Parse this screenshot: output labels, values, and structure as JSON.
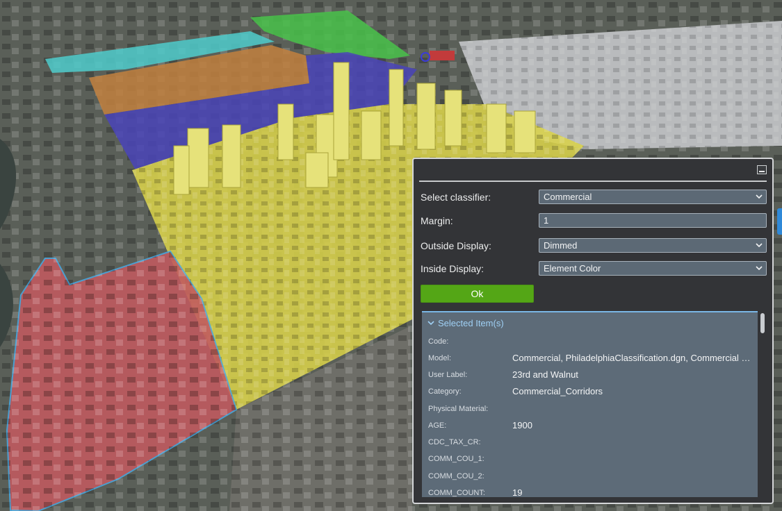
{
  "viewport": {
    "name": "3D city map — Philadelphia classification",
    "zones": [
      {
        "name": "commercial-zone-yellow",
        "color": "#d8d24a"
      },
      {
        "name": "residential-zone-red",
        "color": "#c25a5f"
      },
      {
        "name": "zone-blue",
        "color": "#4a44b8"
      },
      {
        "name": "zone-orange",
        "color": "#c2803e"
      },
      {
        "name": "zone-cyan",
        "color": "#4fcbcb"
      },
      {
        "name": "zone-green",
        "color": "#49c24a"
      }
    ]
  },
  "panel": {
    "minimize_icon": "minimize-icon",
    "classifier": {
      "label": "Select classifier:",
      "value": "Commercial"
    },
    "margin": {
      "label": "Margin:",
      "value": "1"
    },
    "outside_display": {
      "label": "Outside Display:",
      "value": "Dimmed"
    },
    "inside_display": {
      "label": "Inside Display:",
      "value": "Element Color"
    },
    "ok_label": "Ok",
    "selected_items": {
      "title": "Selected Item(s)",
      "rows": [
        {
          "key": "Code:",
          "value": ""
        },
        {
          "key": "Model:",
          "value": "Commercial, PhiladelphiaClassification.dgn, Commercial Co..."
        },
        {
          "key": "User Label:",
          "value": "23rd and Walnut"
        },
        {
          "key": "Category:",
          "value": "Commercial_Corridors"
        },
        {
          "key": "Physical Material:",
          "value": ""
        },
        {
          "key": "AGE:",
          "value": "1900"
        },
        {
          "key": "CDC_TAX_CR:",
          "value": ""
        },
        {
          "key": "COMM_COU_1:",
          "value": ""
        },
        {
          "key": "COMM_COU_2:",
          "value": ""
        },
        {
          "key": "COMM_COUNT:",
          "value": "19"
        }
      ]
    }
  },
  "colors": {
    "accent_blue": "#2f89d8",
    "ok_green": "#54a616",
    "panel_bg": "#333437",
    "props_bg": "#5d6b78"
  }
}
